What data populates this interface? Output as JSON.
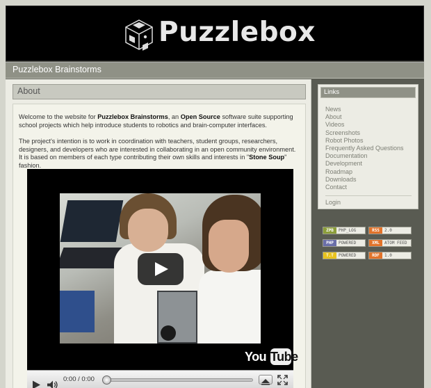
{
  "header": {
    "logo_text": "Puzzlebox",
    "logo_icon": "puzzle-cube-icon"
  },
  "site": {
    "title": "Puzzlebox Brainstorms"
  },
  "main": {
    "heading": "About",
    "para1": {
      "t1": "Welcome to the website for ",
      "b1": "Puzzlebox Brainstorms",
      "t2": ", an ",
      "b2": "Open Source",
      "t3": " software suite supporting school projects which help introduce students to robotics and brain-computer interfaces."
    },
    "para2": {
      "t1": "The project's intention is to work in coordination with teachers, student groups, researchers, designers, and developers who are interested in collaborating in an open community environment. It is based on members of each type contributing their own skills and interests in \"",
      "b1": "Stone Soup",
      "t2": "\" fashion."
    },
    "video": {
      "brand_you": "You",
      "brand_tube": "Tube",
      "time": "0:00 / 0:00",
      "progress": 0
    }
  },
  "sidebar": {
    "links_heading": "Links",
    "links": [
      "News",
      "About",
      "Videos",
      "Screenshots",
      "Robot Photos",
      "Frequently Asked Questions",
      "Documentation",
      "Development",
      "Roadmap",
      "Downloads",
      "Contact"
    ],
    "login": "Login",
    "badges": [
      {
        "left": "ZPB",
        "right": "PHP_LOG",
        "color": "#8c9e3a"
      },
      {
        "left": "RSS",
        "right": "2.0",
        "color": "#e2732a"
      },
      {
        "left": "PHP",
        "right": "POWERED",
        "color": "#6a6ea8"
      },
      {
        "left": "XML",
        "right": "ATOM FEED",
        "color": "#e2732a"
      },
      {
        "left": "T.T",
        "right": "POWERED",
        "color": "#e8c21e"
      },
      {
        "left": "RDF",
        "right": "1.0",
        "color": "#e2732a"
      }
    ]
  }
}
